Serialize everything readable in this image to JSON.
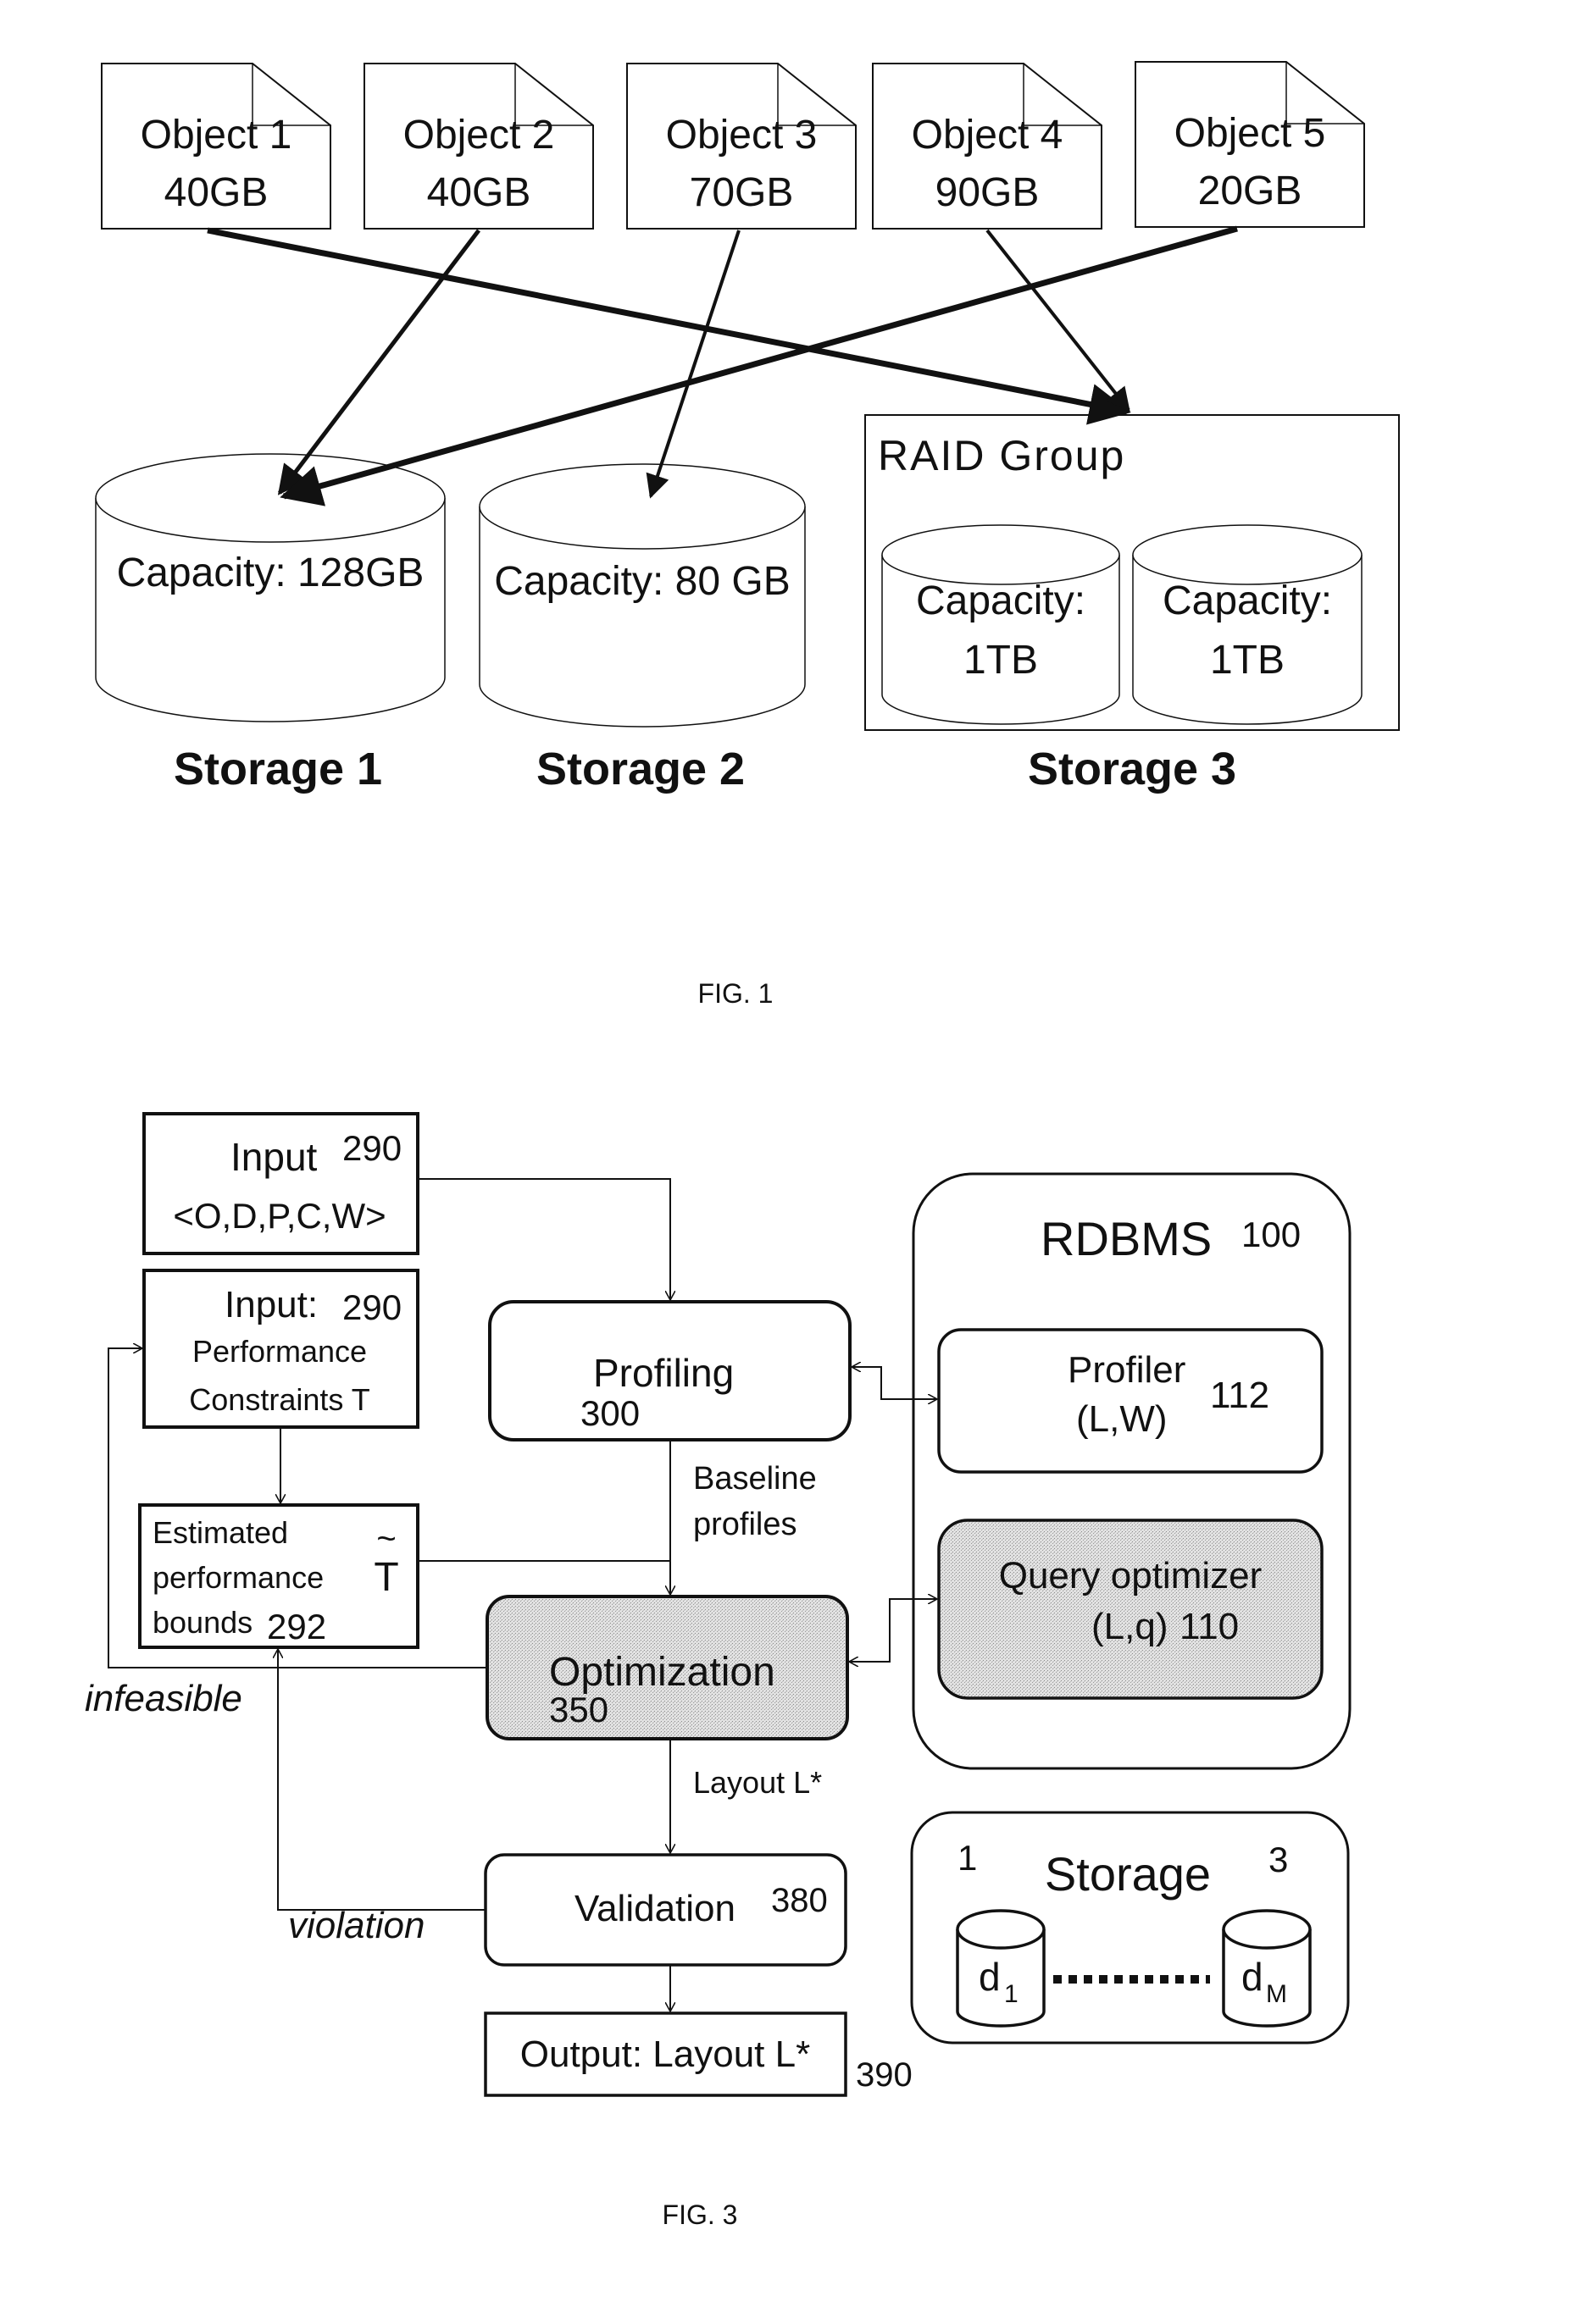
{
  "fig1": {
    "caption": "FIG. 1",
    "objects": [
      {
        "name": "Object 1",
        "size": "40GB"
      },
      {
        "name": "Object 2",
        "size": "40GB"
      },
      {
        "name": "Object 3",
        "size": "70GB"
      },
      {
        "name": "Object 4",
        "size": "90GB"
      },
      {
        "name": "Object 5",
        "size": "20GB"
      }
    ],
    "storages": [
      {
        "label": "Storage 1",
        "capacity": "Capacity: 128GB"
      },
      {
        "label": "Storage 2",
        "capacity": "Capacity: 80 GB"
      },
      {
        "label": "Storage 3",
        "group_title": "RAID Group",
        "disks": [
          {
            "line1": "Capacity:",
            "line2": "1TB"
          },
          {
            "line1": "Capacity:",
            "line2": "1TB"
          }
        ]
      }
    ],
    "assignments": [
      {
        "object": "Object 1",
        "storage": "Storage 3"
      },
      {
        "object": "Object 2",
        "storage": "Storage 1"
      },
      {
        "object": "Object 3",
        "storage": "Storage 2"
      },
      {
        "object": "Object 4",
        "storage": "Storage 3"
      },
      {
        "object": "Object 5",
        "storage": "Storage 1"
      }
    ]
  },
  "fig3": {
    "caption": "FIG. 3",
    "input_main": {
      "title": "Input",
      "ref": "290",
      "value": "<O,D,P,C,W>"
    },
    "input_constraints": {
      "title": "Input:",
      "ref": "290",
      "line1": "Performance",
      "line2": "Constraints T"
    },
    "estimated": {
      "line1": "Estimated",
      "line2": "performance",
      "line3": "bounds",
      "ref": "292",
      "symbol_tilde": "~",
      "symbol": "T"
    },
    "profiling": {
      "label": "Profiling",
      "ref": "300"
    },
    "baseline": {
      "line1": "Baseline",
      "line2": "profiles"
    },
    "optimization": {
      "label": "Optimization",
      "ref": "350"
    },
    "layout_edge": "Layout L*",
    "validation": {
      "label": "Validation",
      "ref": "380"
    },
    "output": {
      "label": "Output: Layout L*",
      "ref": "390"
    },
    "infeasible": "infeasible",
    "violation": "violation",
    "rdbms": {
      "label": "RDBMS",
      "ref": "100"
    },
    "profiler": {
      "line1": "Profiler",
      "line2": "(L,W)",
      "ref": "112"
    },
    "query_optimizer": {
      "line1": "Query optimizer",
      "line2": "(L,q)",
      "ref": "110"
    },
    "storage": {
      "label": "Storage",
      "left_num": "1",
      "right_num": "3",
      "disk_first": "d",
      "disk_first_sub": "1",
      "disk_last": "d",
      "disk_last_sub": "M"
    }
  }
}
